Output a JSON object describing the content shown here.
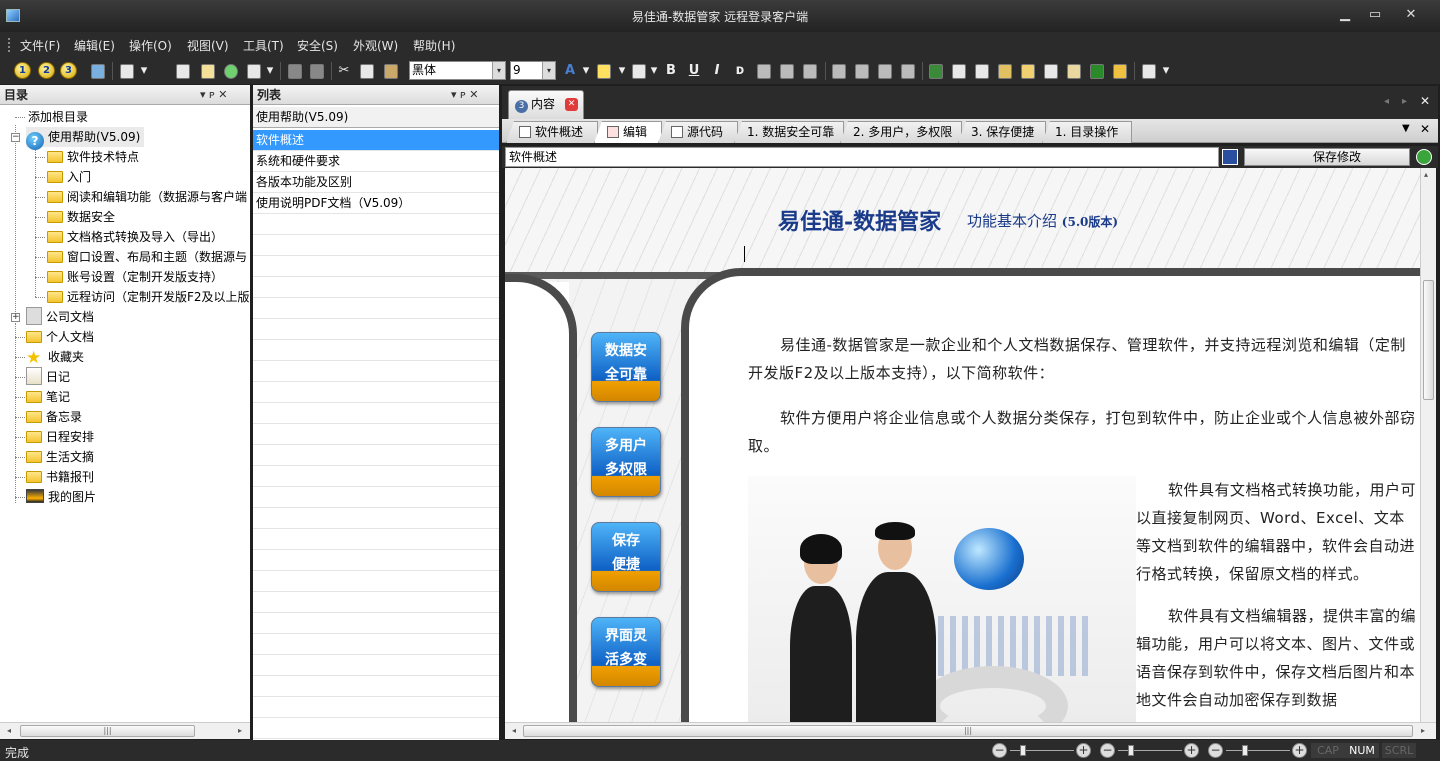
{
  "window": {
    "title": "易佳通-数据管家 远程登录客户端",
    "min": "▁",
    "max": "▭",
    "close": "✕"
  },
  "menu": [
    "文件(F)",
    "编辑(E)",
    "操作(O)",
    "视图(V)",
    "工具(T)",
    "安全(S)",
    "外观(W)",
    "帮助(H)"
  ],
  "toolbar": {
    "nums": [
      "1",
      "2",
      "3"
    ],
    "font_name": "黑体",
    "font_size": "9",
    "bold": "B",
    "underline": "U",
    "italic": "I",
    "strike": "ᴅ",
    "arrow": "▾",
    "cut": "✂"
  },
  "tree_panel": {
    "title": "目录",
    "pin": "▾ ᴘ ✕",
    "items": [
      {
        "label": "添加根目录",
        "icon": "none"
      },
      {
        "label": "使用帮助(V5.09)",
        "icon": "help-icon"
      },
      {
        "label": "软件技术特点",
        "icon": "folder-icon"
      },
      {
        "label": "入门",
        "icon": "folder-icon"
      },
      {
        "label": "阅读和编辑功能（数据源与客户端",
        "icon": "folder-icon"
      },
      {
        "label": "数据安全",
        "icon": "folder-icon"
      },
      {
        "label": "文档格式转换及导入（导出）",
        "icon": "folder-icon"
      },
      {
        "label": "窗口设置、布局和主题（数据源与",
        "icon": "folder-icon"
      },
      {
        "label": "账号设置（定制开发版支持）",
        "icon": "folder-icon"
      },
      {
        "label": "远程访问（定制开发版F2及以上版",
        "icon": "folder-icon"
      },
      {
        "label": "公司文档",
        "icon": "book-icon"
      },
      {
        "label": "个人文档",
        "icon": "folder-icon"
      },
      {
        "label": "收藏夹",
        "icon": "star-icon"
      },
      {
        "label": "日记",
        "icon": "notebook-icon"
      },
      {
        "label": "笔记",
        "icon": "folder-icon"
      },
      {
        "label": "备忘录",
        "icon": "folder-icon"
      },
      {
        "label": "日程安排",
        "icon": "folder-icon"
      },
      {
        "label": "生活文摘",
        "icon": "folder-icon"
      },
      {
        "label": "书籍报刊",
        "icon": "folder-icon"
      },
      {
        "label": "我的图片",
        "icon": "picture-icon"
      }
    ],
    "plus": "+",
    "minus": "−"
  },
  "list_panel": {
    "title": "列表",
    "header": "使用帮助(V5.09)",
    "rows": [
      "软件概述",
      "系统和硬件要求",
      "各版本功能及区别",
      "使用说明PDF文档（V5.09）"
    ]
  },
  "doc_tab": {
    "badge": "3",
    "label": "内容",
    "close": "✕"
  },
  "sub_tabs": [
    "软件概述",
    "编辑",
    "源代码",
    "1. 数据安全可靠",
    "2. 多用户，多权限",
    "3. 保存便捷",
    "1. 目录操作"
  ],
  "doc_title": "软件概述",
  "save_label": "保存修改",
  "doc": {
    "heading": "易佳通-数据管家",
    "subheading": "功能基本介绍",
    "version": "(5.0版本)",
    "features": [
      "数据安\n全可靠",
      "多用户\n多权限",
      "保存\n便捷",
      "界面灵\n活多变"
    ],
    "p1": "易佳通-数据管家是一款企业和个人文档数据保存、管理软件，并支持远程浏览和编辑（定制开发版F2及以上版本支持），以下简称软件：",
    "p2": "软件方便用户将企业信息或个人数据分类保存，打包到软件中，防止企业或个人信息被外部窃取。",
    "p3": "软件具有文档格式转换功能，用户可以直接复制网页、Word、Excel、文本等文档到软件的编辑器中，软件会自动进行格式转换，保留原文档的样式。",
    "p4": "软件具有文档编辑器，提供丰富的编辑功能，用户可以将文本、图片、文件或语音保存到软件中，保存文档后图片和本地文件会自动加密保存到数据"
  },
  "status": {
    "text": "完成",
    "cap": "CAP",
    "num": "NUM",
    "scrl": "SCRL"
  }
}
